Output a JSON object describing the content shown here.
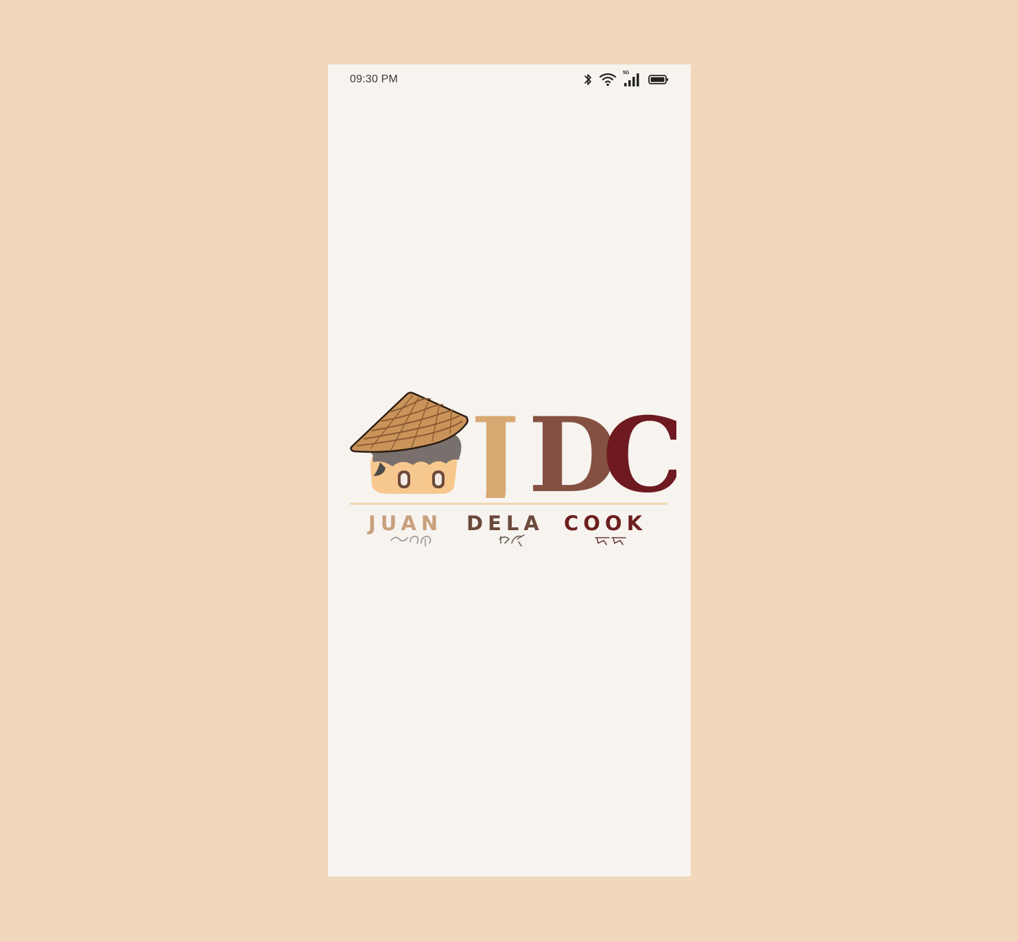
{
  "status_bar": {
    "time": "09:30 PM",
    "icons": [
      "bluetooth-icon",
      "wifi-icon",
      "signal-icon",
      "battery-icon"
    ],
    "network_label": "5G"
  },
  "logo": {
    "monogram": [
      "J",
      "D",
      "C"
    ],
    "words": [
      "JUAN",
      "DELA",
      "COOK"
    ],
    "colors": {
      "j": "#d8a872",
      "d": "#845041",
      "c": "#6e1a20",
      "juan": "#c9a07c",
      "dela": "#6b4a3c",
      "cook": "#6e1f1f",
      "rule": "#f0d8b2"
    }
  },
  "colors": {
    "background": "#f1d7bb",
    "screen": "#f7f3ef"
  }
}
